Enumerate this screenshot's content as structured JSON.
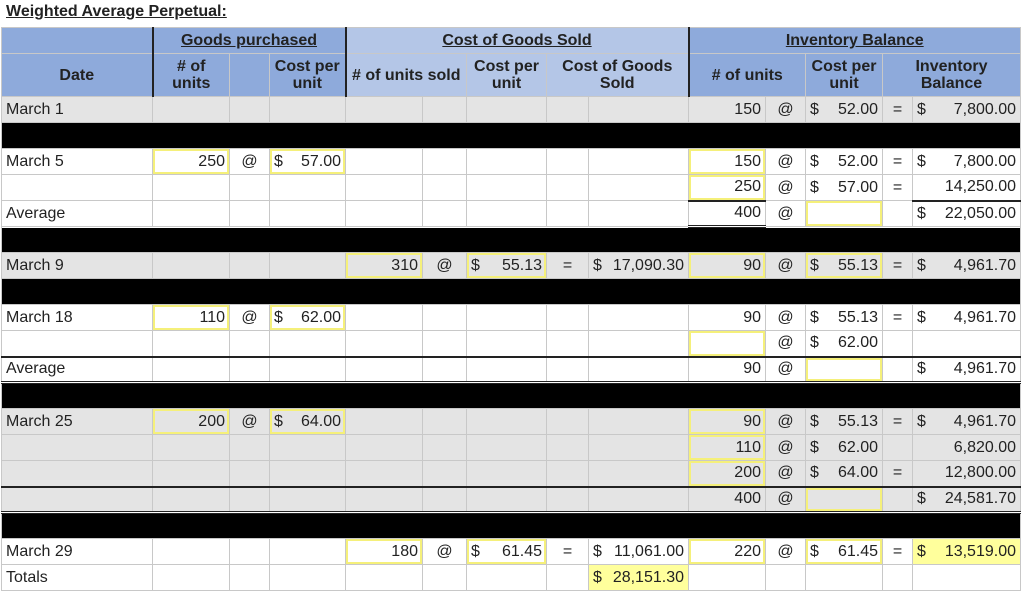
{
  "title": "Weighted Average Perpetual:",
  "header": {
    "date": "Date",
    "groups": {
      "goods_purchased": "Goods purchased",
      "cogs": "Cost of Goods Sold",
      "inventory_balance": "Inventory Balance"
    },
    "goods_purchased": {
      "units": "# of units",
      "cost_per_unit": "Cost per unit"
    },
    "cogs": {
      "units_sold": "# of units sold",
      "cost_per_unit": "Cost per unit",
      "cogs": "Cost of Goods Sold"
    },
    "inventory": {
      "units": "# of units",
      "cost_per_unit": "Cost per unit",
      "balance": "Inventory Balance"
    }
  },
  "symbols": {
    "at": "@",
    "eq": "=",
    "dollar": "$"
  },
  "rows": {
    "march1": {
      "label": "March 1",
      "inv_units": "150",
      "inv_cost": "52.00",
      "inv_balance": "7,800.00"
    },
    "march5": {
      "label": "March 5",
      "gp_units": "250",
      "gp_cost": "57.00",
      "lines": [
        {
          "inv_units": "150",
          "inv_cost": "52.00",
          "inv_balance": "7,800.00"
        },
        {
          "inv_units": "250",
          "inv_cost": "57.00",
          "inv_balance": "14,250.00"
        }
      ],
      "average": {
        "label": "Average",
        "inv_units": "400",
        "inv_cost": "",
        "inv_balance": "22,050.00"
      }
    },
    "march9": {
      "label": "March 9",
      "cogs_units": "310",
      "cogs_cost": "55.13",
      "cogs_total": "17,090.30",
      "inv_units": "90",
      "inv_cost": "55.13",
      "inv_balance": "4,961.70"
    },
    "march18": {
      "label": "March 18",
      "gp_units": "110",
      "gp_cost": "62.00",
      "lines": [
        {
          "inv_units": "90",
          "inv_cost": "55.13",
          "inv_balance": "4,961.70"
        },
        {
          "inv_units": "",
          "inv_cost": "62.00",
          "inv_balance": ""
        }
      ],
      "average": {
        "label": "Average",
        "inv_units": "90",
        "inv_cost": "",
        "inv_balance": "4,961.70"
      }
    },
    "march25": {
      "label": "March 25",
      "gp_units": "200",
      "gp_cost": "64.00",
      "lines": [
        {
          "inv_units": "90",
          "inv_cost": "55.13",
          "inv_balance": "4,961.70"
        },
        {
          "inv_units": "110",
          "inv_cost": "62.00",
          "inv_balance": "6,820.00"
        },
        {
          "inv_units": "200",
          "inv_cost": "64.00",
          "inv_balance": "12,800.00"
        }
      ],
      "average": {
        "label": "",
        "inv_units": "400",
        "inv_cost": "",
        "inv_balance": "24,581.70"
      }
    },
    "march29": {
      "label": "March 29",
      "cogs_units": "180",
      "cogs_cost": "61.45",
      "cogs_total": "11,061.00",
      "inv_units": "220",
      "inv_cost": "61.45",
      "inv_balance": "13,519.00"
    },
    "totals": {
      "label": "Totals",
      "cogs_total": "28,151.30"
    }
  }
}
